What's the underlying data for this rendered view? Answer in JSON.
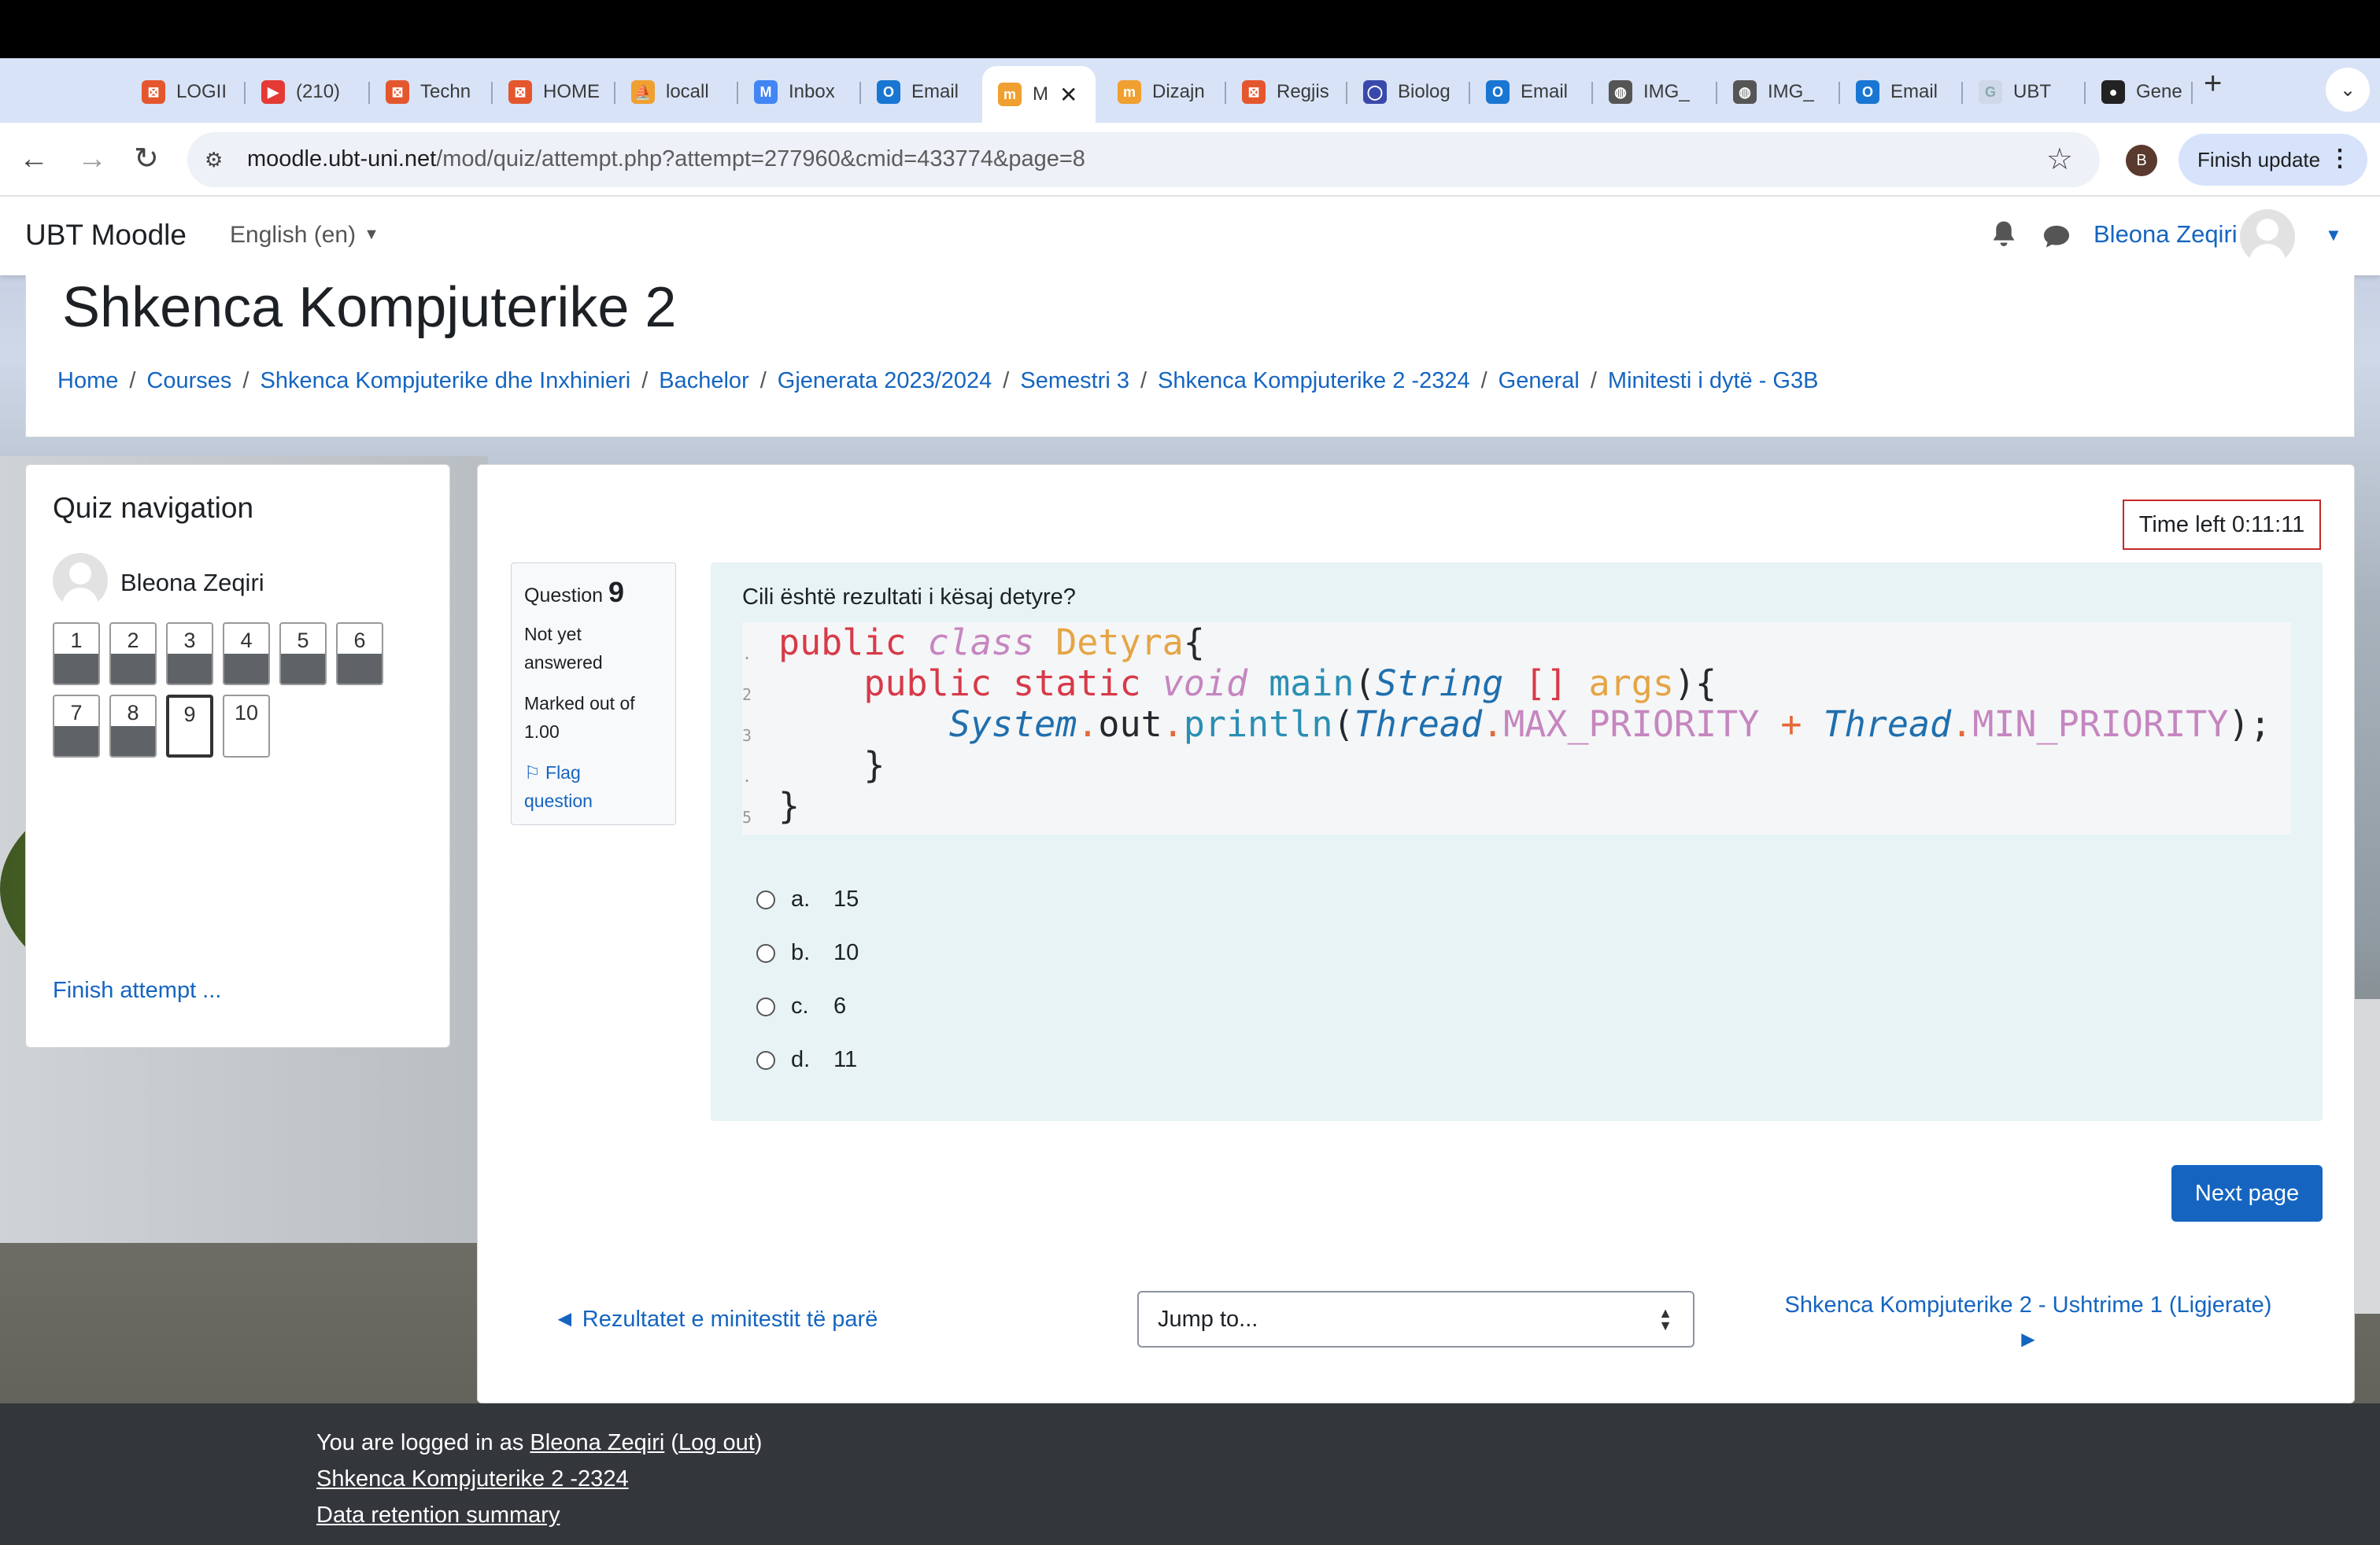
{
  "browser": {
    "tabs": [
      {
        "label": "LOGII",
        "color": "#e4572e"
      },
      {
        "label": "(210)",
        "color": "#e53935"
      },
      {
        "label": "Techn",
        "color": "#e4572e"
      },
      {
        "label": "HOME",
        "color": "#e4572e"
      },
      {
        "label": "locall",
        "color": "#f0a030"
      },
      {
        "label": "Inbox",
        "color": "#4285f4"
      },
      {
        "label": "Email",
        "color": "#1976d2"
      },
      {
        "label": "M",
        "color": "#f0a030",
        "active": true
      },
      {
        "label": "Dizajn",
        "color": "#f0a030"
      },
      {
        "label": "Regjis",
        "color": "#e4572e"
      },
      {
        "label": "Biolog",
        "color": "#3949ab"
      },
      {
        "label": "Email",
        "color": "#1976d2"
      },
      {
        "label": "IMG_",
        "color": "#555555"
      },
      {
        "label": "IMG_",
        "color": "#555555"
      },
      {
        "label": "Email",
        "color": "#1976d2"
      },
      {
        "label": "UBT",
        "color": "#cfd8e8"
      },
      {
        "label": "Gene",
        "color": "#222222"
      }
    ],
    "url_host": "moodle.ubt-uni.net",
    "url_path": "/mod/quiz/attempt.php?attempt=277960&cmid=433774&page=8",
    "profile_initial": "B",
    "finish_update": "Finish update"
  },
  "navbar": {
    "brand": "UBT Moodle",
    "language": "English (en)",
    "user": "Bleona Zeqiri"
  },
  "header": {
    "title": "Shkenca Kompjuterike 2",
    "breadcrumb": [
      "Home",
      "Courses",
      "Shkenca Kompjuterike dhe Inxhinieri",
      "Bachelor",
      "Gjenerata 2023/2024",
      "Semestri 3",
      "Shkenca Kompjuterike 2 -2324",
      "General",
      "Minitesti i dytë - G3B"
    ]
  },
  "quiz_nav": {
    "title": "Quiz navigation",
    "user": "Bleona Zeqiri",
    "questions": [
      "1",
      "2",
      "3",
      "4",
      "5",
      "6",
      "7",
      "8",
      "9",
      "10"
    ],
    "finish": "Finish attempt ..."
  },
  "question": {
    "time_left": "Time left 0:11:11",
    "label": "Question",
    "number": "9",
    "state_line1": "Not yet",
    "state_line2": "answered",
    "grade_line1": "Marked out of",
    "grade_line2": "1.00",
    "flag_line1": "Flag",
    "flag_line2": "question",
    "text": "Cili është rezultati i kësaj detyre?",
    "code": {
      "l1_kw": "public",
      "l1_cls": "class",
      "l1_name": "Detyra",
      "l1_brace": "{",
      "l2_kw": "public static",
      "l2_void": "void",
      "l2_fn": "main",
      "l2_p1": "(",
      "l2_type": "String",
      "l2_arr": "[]",
      "l2_arg": "args",
      "l2_end": "){",
      "l3_sys": "System",
      "l3_dot1": ".",
      "l3_out": "out",
      "l3_dot2": ".",
      "l3_fn": "println",
      "l3_p1": "(",
      "l3_t1": "Thread",
      "l3_dot3": ".",
      "l3_c1": "MAX_PRIORITY",
      "l3_plus": "+",
      "l3_t2": "Thread",
      "l3_dot4": ".",
      "l3_c2": "MIN_PRIORITY",
      "l3_end": ");",
      "l4": "}",
      "l5": "}"
    },
    "answers": [
      {
        "letter": "a.",
        "value": "15"
      },
      {
        "letter": "b.",
        "value": "10"
      },
      {
        "letter": "c.",
        "value": "6"
      },
      {
        "letter": "d.",
        "value": "11"
      }
    ],
    "next": "Next page"
  },
  "activity_nav": {
    "prev": "◄ Rezultatet e minitestit të parë",
    "jump": "Jump to...",
    "next_line1": "Shkenca Kompjuterike 2 - Ushtrime 1 (Ligjerate)",
    "next_line2": "►"
  },
  "footer": {
    "logged_prefix": "You are logged in as ",
    "user": "Bleona Zeqiri",
    "logout_open": " (",
    "logout": "Log out",
    "logout_close": ")",
    "course": "Shkenca Kompjuterike 2 -2324",
    "retention": "Data retention summary"
  },
  "colors": {
    "accent": "#1565c0",
    "timer_border": "#c62828",
    "footer": "#33363a"
  }
}
